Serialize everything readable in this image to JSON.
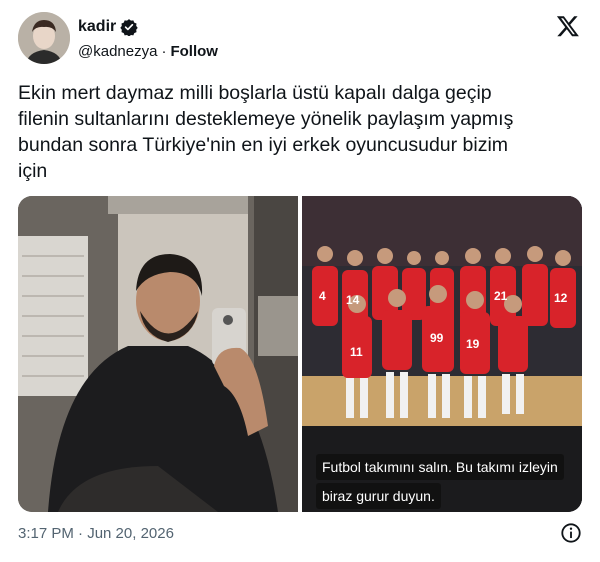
{
  "author": {
    "display_name": "kadir",
    "handle": "@kadnezya",
    "separator": "·",
    "follow_label": "Follow",
    "verified": true
  },
  "icons": {
    "verified": "verified-badge-icon",
    "logo": "x-logo-icon",
    "info": "info-icon"
  },
  "tweet": {
    "text": "Ekin mert daymaz milli boşlarla üstü kapalı dalga geçip\nfilenin sultanlarını desteklemeye yönelik paylaşım yapmış\nbundan sonra Türkiye'nin en iyi erkek oyuncusudur bizim\niçin"
  },
  "media": {
    "right_photo": {
      "caption_lines": [
        "Futbol takımını salın. Bu takımı izleyin",
        "biraz gurur duyun."
      ],
      "jersey_numbers": [
        "4",
        "14",
        "21",
        "12",
        "11",
        "99",
        "19"
      ]
    }
  },
  "footer": {
    "timestamp": "3:17 PM · Jun 20, 2026"
  },
  "colors": {
    "text": "#0f1419",
    "muted": "#536471",
    "verified_bg": "#0f1419",
    "jersey_red": "#d8232a"
  }
}
